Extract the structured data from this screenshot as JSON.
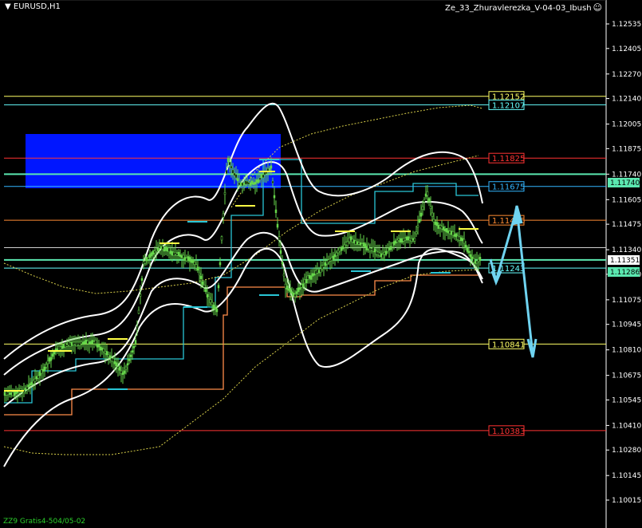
{
  "window": {
    "symbol_timeframe": "EURUSD,H1",
    "indicator_name": "Ze_33_Zhuravlerezka_V-04-03_Ibush",
    "footer_text": "ZZ9 Gratis4-504/05-02"
  },
  "price_axis": {
    "ticks": [
      "1.12535",
      "1.12405",
      "1.12270",
      "1.12140",
      "1.12005",
      "1.11875",
      "1.11740",
      "1.11605",
      "1.11475",
      "1.11340",
      "1.11210",
      "1.11075",
      "1.10945",
      "1.10810",
      "1.10675",
      "1.10545",
      "1.10410",
      "1.10280",
      "1.10145",
      "1.10015"
    ],
    "current_price": "1.11351",
    "current_price_secondary": "1.11286",
    "highlight_price": "1.11740"
  },
  "levels": [
    {
      "price": "1.12152",
      "color": "#ffff66"
    },
    {
      "price": "1.12107",
      "color": "#66ffff"
    },
    {
      "price": "1.11825",
      "color": "#ff3333"
    },
    {
      "price": "1.11675",
      "color": "#33b5ff"
    },
    {
      "price": "1.11496",
      "color": "#ff8c33"
    },
    {
      "price": "1.11243",
      "color": "#66ffff"
    },
    {
      "price": "1.10841",
      "color": "#ffff66"
    },
    {
      "price": "1.10383",
      "color": "#ff3333"
    }
  ],
  "colors": {
    "background": "#000000",
    "candles": "#66d64b",
    "bands": "#ffffff",
    "zone": "#0016ff",
    "forecast": "#6fd3f0",
    "step_orange": "#ff8c4a",
    "step_cyan": "#29c6d6"
  }
}
